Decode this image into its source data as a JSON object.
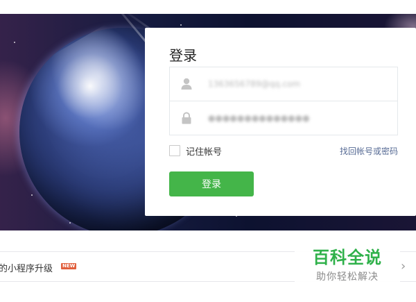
{
  "login": {
    "title": "登录",
    "account_value": "1363656789@qq.com",
    "password_value": "●●●●●●●●●●●●●●",
    "remember_label": "记住帐号",
    "forgot_link": "找回帐号或密码",
    "submit_label": "登录"
  },
  "notice": {
    "text": "的小程序升级",
    "badge": "NEW"
  },
  "watermark": {
    "main": "百科全说",
    "sub": "助你轻松解决"
  },
  "colors": {
    "primary_button": "#44b549",
    "link": "#576b95",
    "badge": "#e15f3c",
    "watermark_green": "#2fb14a"
  },
  "icons": [
    "user-icon",
    "lock-icon",
    "chevron-right-icon"
  ]
}
